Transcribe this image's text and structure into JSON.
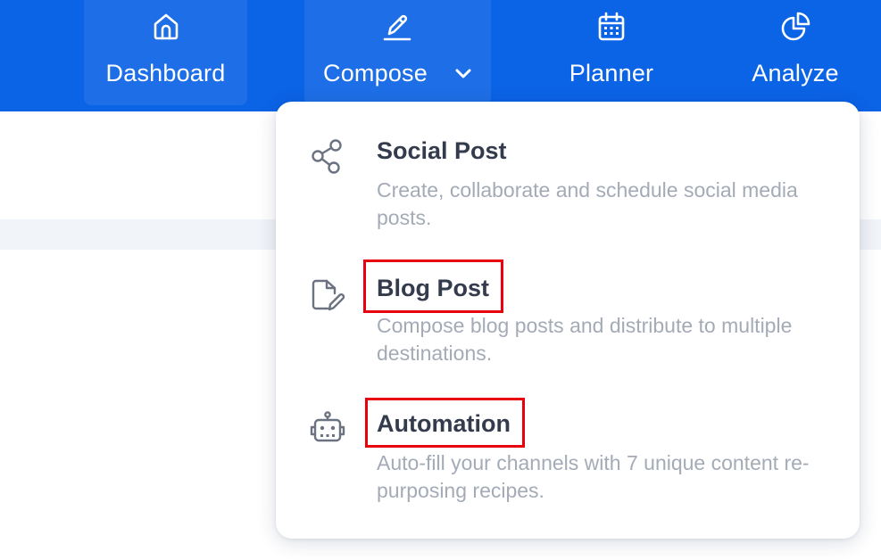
{
  "topnav": {
    "items": [
      {
        "label": "Dashboard",
        "icon": "home-icon"
      },
      {
        "label": "Compose",
        "icon": "pen-icon",
        "expanded": true
      },
      {
        "label": "Planner",
        "icon": "calendar-icon"
      },
      {
        "label": "Analyze",
        "icon": "pie-chart-icon"
      }
    ]
  },
  "compose_menu": {
    "items": [
      {
        "title": "Social Post",
        "description": "Create, collaborate and schedule social media posts.",
        "icon": "share-icon"
      },
      {
        "title": "Blog Post",
        "description": "Compose blog posts and distribute to multiple destinations.",
        "icon": "file-edit-icon"
      },
      {
        "title": "Automation",
        "description": "Auto-fill your channels with 7 unique content re-purposing recipes.",
        "icon": "robot-icon"
      }
    ]
  },
  "colors": {
    "topbar": "#0b63e5",
    "title_text": "#333b4c",
    "description_text": "#a4abb6",
    "highlight_border": "#e8000f"
  }
}
